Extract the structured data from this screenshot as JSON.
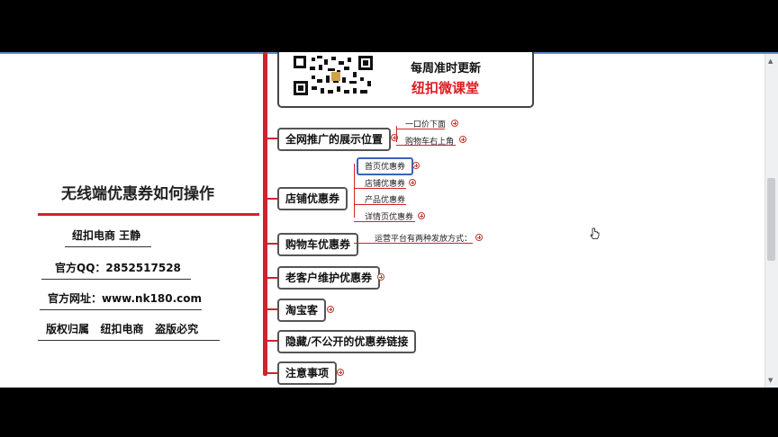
{
  "title": "无线端优惠券如何操作",
  "info": {
    "author": "纽扣电商 王静",
    "qq": "官方QQ：2852517528",
    "website": "官方网址：www.nk180.com",
    "copyright": "版权归属   纽扣电商   盗版必究"
  },
  "qrbox": {
    "line1": "每周准时更新",
    "line2": "纽扣微课堂"
  },
  "nodes": [
    {
      "label": "全网推广的展示位置",
      "children": [
        "一口价下面",
        "购物车右上角"
      ]
    },
    {
      "label": "店铺优惠券",
      "children": [
        "首页优惠券",
        "店铺优惠券",
        "产品优惠券",
        "详情页优惠券"
      ]
    },
    {
      "label": "购物车优惠券",
      "children": [
        "运营平台有两种发放方式："
      ]
    },
    {
      "label": "老客户维护优惠券",
      "children": []
    },
    {
      "label": "淘宝客",
      "children": []
    },
    {
      "label": "隐藏/不公开的优惠券链接",
      "children": []
    },
    {
      "label": "注意事项",
      "children": []
    }
  ],
  "colors": {
    "accent": "#d1222c",
    "highlight": "#3a62b8",
    "qr_red_text": "#e01b22"
  },
  "icons": [
    "qr-code-icon",
    "expand-plus-icon",
    "mouse-pointer-icon"
  ]
}
